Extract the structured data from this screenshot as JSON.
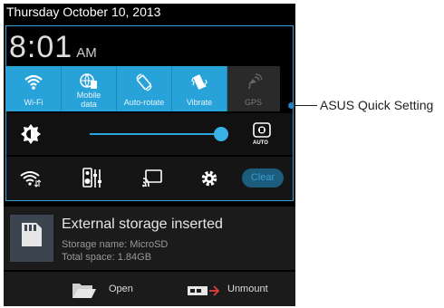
{
  "status_bar": {
    "date": "Thursday October 10, 2013"
  },
  "clock": {
    "time": "8:01",
    "ampm": "AM"
  },
  "quick_settings": {
    "tiles": [
      {
        "label": "Wi-Fi",
        "icon": "wifi-icon",
        "active": true
      },
      {
        "label_line1": "Mobile",
        "label_line2": "data",
        "icon": "mobile-data-icon",
        "active": true
      },
      {
        "label": "Auto-rotate",
        "icon": "auto-rotate-icon",
        "active": true
      },
      {
        "label": "Vibrate",
        "icon": "vibrate-icon",
        "active": true
      },
      {
        "label": "GPS",
        "icon": "gps-icon",
        "active": false
      }
    ],
    "brightness": {
      "level": 0.93,
      "auto_label": "AUTO"
    },
    "shortcuts": [
      "wifi-settings-icon",
      "audio-settings-icon",
      "screen-cast-icon",
      "settings-gear-icon"
    ],
    "clear_label": "Clear"
  },
  "notification": {
    "title": "External storage inserted",
    "line1": "Storage name: MicroSD",
    "line2": "Total space: 1.84GB",
    "actions": {
      "open_label": "Open",
      "unmount_label": "Unmount"
    }
  },
  "callout": {
    "label": "ASUS Quick Setting"
  },
  "colors": {
    "accent": "#27a3d9",
    "background": "#000000"
  }
}
